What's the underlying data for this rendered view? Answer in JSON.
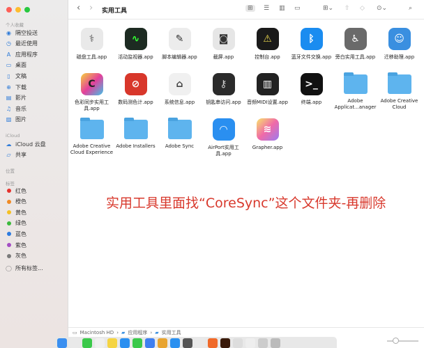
{
  "window": {
    "title": "实用工具"
  },
  "sidebar": {
    "favorites_header": "个人收藏",
    "favorites": [
      {
        "label": "隔空投送",
        "icon": "airdrop-icon",
        "g": "◉"
      },
      {
        "label": "最近使用",
        "icon": "clock-icon",
        "g": "◷"
      },
      {
        "label": "应用程序",
        "icon": "applications-icon",
        "g": "A"
      },
      {
        "label": "桌面",
        "icon": "desktop-icon",
        "g": "▭"
      },
      {
        "label": "文稿",
        "icon": "document-icon",
        "g": "▯"
      },
      {
        "label": "下载",
        "icon": "download-icon",
        "g": "⊕"
      },
      {
        "label": "影片",
        "icon": "movies-icon",
        "g": "▤"
      },
      {
        "label": "音乐",
        "icon": "music-icon",
        "g": "♫"
      },
      {
        "label": "图片",
        "icon": "pictures-icon",
        "g": "▨"
      }
    ],
    "icloud_header": "iCloud",
    "icloud": [
      {
        "label": "iCloud 云盘",
        "icon": "cloud-icon",
        "g": "☁"
      },
      {
        "label": "共享",
        "icon": "shared-folder-icon",
        "g": "▱"
      }
    ],
    "locations_header": "位置",
    "tags_header": "标签",
    "tags": [
      {
        "label": "红色",
        "color": "#e5322d"
      },
      {
        "label": "橙色",
        "color": "#f08a24"
      },
      {
        "label": "黄色",
        "color": "#f5c023"
      },
      {
        "label": "绿色",
        "color": "#3cb93c"
      },
      {
        "label": "蓝色",
        "color": "#2d7be0"
      },
      {
        "label": "紫色",
        "color": "#a44ec4"
      },
      {
        "label": "灰色",
        "color": "#7b7b7b"
      }
    ],
    "all_tags": "所有标签..."
  },
  "toolbar": {
    "back": "‹",
    "forward": "›",
    "view_icons": "⊞",
    "view_list": "☰",
    "view_columns": "▥",
    "view_gallery": "▭",
    "group": "⊞⌄",
    "share": "⇧",
    "tag": "◇",
    "more": "⊙⌄",
    "search": "⌕"
  },
  "items": [
    {
      "label": "磁盘工具.app",
      "kind": "app",
      "bg": "#e9e9e9",
      "fg": "#555",
      "g": "⚕"
    },
    {
      "label": "活动监视器.app",
      "kind": "app",
      "bg": "#1d2b22",
      "fg": "#3f3",
      "g": "∿"
    },
    {
      "label": "脚本编辑器.app",
      "kind": "app",
      "bg": "#ececec",
      "fg": "#333",
      "g": "✎"
    },
    {
      "label": "截屏.app",
      "kind": "app",
      "bg": "#e6e6e6",
      "fg": "#333",
      "g": "◙"
    },
    {
      "label": "控制台.app",
      "kind": "app",
      "bg": "#1a1a1a",
      "fg": "#e8d44d",
      "g": "⚠"
    },
    {
      "label": "蓝牙文件交换.app",
      "kind": "app",
      "bg": "#1a8cf0",
      "fg": "#fff",
      "g": "ᛒ"
    },
    {
      "label": "旁白实用工具.app",
      "kind": "app",
      "bg": "#6a6a6a",
      "fg": "#fff",
      "g": "♿"
    },
    {
      "label": "迁移助理.app",
      "kind": "app",
      "bg": "#3a8fe0",
      "fg": "#fff",
      "g": "☺"
    },
    {
      "label": "色彩同步实用工具.app",
      "kind": "app",
      "bg": "linear-gradient(135deg,#f6d23b,#e4409b,#3ec3e8)",
      "fg": "#222",
      "g": "C"
    },
    {
      "label": "数码测色计.app",
      "kind": "app",
      "bg": "#d8372b",
      "fg": "#fff",
      "g": "⊘"
    },
    {
      "label": "系统信息.app",
      "kind": "app",
      "bg": "#f0f0f0",
      "fg": "#444",
      "g": "⌂"
    },
    {
      "label": "钥匙串访问.app",
      "kind": "app",
      "bg": "#2b2b2b",
      "fg": "#ccc",
      "g": "⚷"
    },
    {
      "label": "音频MIDI设置.app",
      "kind": "app",
      "bg": "#222",
      "fg": "#fff",
      "g": "▥"
    },
    {
      "label": "终端.app",
      "kind": "app",
      "bg": "#111",
      "fg": "#fff",
      "g": ">_"
    },
    {
      "label": "Adobe Applicat...anager",
      "kind": "folder"
    },
    {
      "label": "Adobe Creative Cloud",
      "kind": "folder"
    },
    {
      "label": "Adobe Creative Cloud Experience",
      "kind": "folder"
    },
    {
      "label": "Adobe Installers",
      "kind": "folder"
    },
    {
      "label": "Adobe Sync",
      "kind": "folder"
    },
    {
      "label": "AirPort实用工具.app",
      "kind": "app",
      "bg": "#2a8ff0",
      "fg": "#fff",
      "g": "◠"
    },
    {
      "label": "Grapher.app",
      "kind": "app",
      "bg": "linear-gradient(135deg,#f8e36a,#f06aa8,#9a7bf0)",
      "fg": "#fff",
      "g": "≋"
    }
  ],
  "annotation": "实用工具里面找“CoreSync”这个文件夹-再删除",
  "pathbar": [
    "Macintosh HD",
    "应用程序",
    "实用工具"
  ],
  "dock": [
    "#3a8ff0",
    "#e9e9e9",
    "#3bc94a",
    "#f0f0f0",
    "#f5d443",
    "#2a8ff0",
    "#3ac94a",
    "#3f7ff0",
    "#e8a430",
    "#2a90f0",
    "#555",
    "#e9e9e9",
    "#f06a2a",
    "#3a1a0a",
    "#ddd",
    "#eee",
    "#ccc",
    "#bbb"
  ]
}
